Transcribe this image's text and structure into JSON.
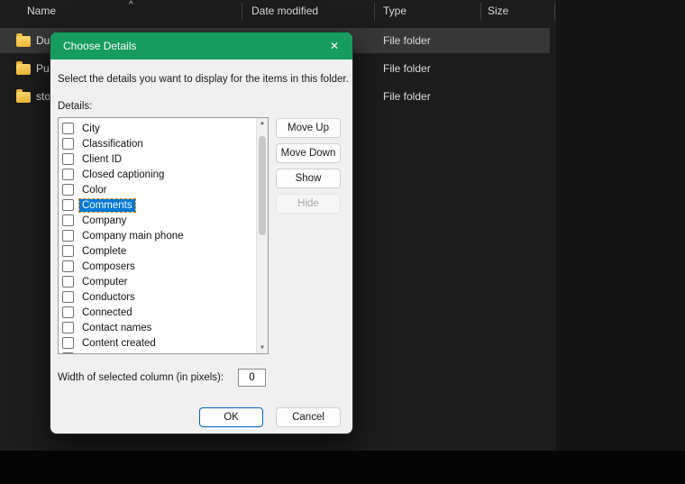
{
  "colors": {
    "titlebar_green": "#169c5e",
    "selection_blue": "#0078d4",
    "focus_ring_orange": "#e07f00",
    "ok_border_blue": "#0067c0",
    "folder_yellow": "#f2c04a",
    "explorer_bg": "#1c1c1c",
    "dialog_bg": "#f0f0f0"
  },
  "icons": {
    "sort_asc": "^",
    "close": "✕",
    "scroll_up": "▲",
    "scroll_down": "▼"
  },
  "explorer": {
    "columns": [
      "Name",
      "Date modified",
      "Type",
      "Size"
    ],
    "rows": [
      {
        "name": "Du",
        "type": "File folder"
      },
      {
        "name": "Pu",
        "type": "File folder"
      },
      {
        "name": "sto",
        "type": "File folder"
      }
    ]
  },
  "dialog": {
    "title": "Choose Details",
    "description": "Select the details you want to display for the items in this folder.",
    "details_label": "Details:",
    "items": [
      {
        "label": "City",
        "checked": false
      },
      {
        "label": "Classification",
        "checked": false
      },
      {
        "label": "Client ID",
        "checked": false
      },
      {
        "label": "Closed captioning",
        "checked": false
      },
      {
        "label": "Color",
        "checked": false
      },
      {
        "label": "Comments",
        "checked": false,
        "selected": true
      },
      {
        "label": "Company",
        "checked": false
      },
      {
        "label": "Company main phone",
        "checked": false
      },
      {
        "label": "Complete",
        "checked": false
      },
      {
        "label": "Composers",
        "checked": false
      },
      {
        "label": "Computer",
        "checked": false
      },
      {
        "label": "Conductors",
        "checked": false
      },
      {
        "label": "Connected",
        "checked": false
      },
      {
        "label": "Contact names",
        "checked": false
      },
      {
        "label": "Content created",
        "checked": false
      },
      {
        "label": "",
        "checked": false,
        "partial": true
      }
    ],
    "buttons": {
      "move_up": "Move Up",
      "move_down": "Move Down",
      "show": "Show",
      "hide": "Hide"
    },
    "width_label": "Width of selected column (in pixels):",
    "width_value": "0",
    "ok": "OK",
    "cancel": "Cancel"
  }
}
